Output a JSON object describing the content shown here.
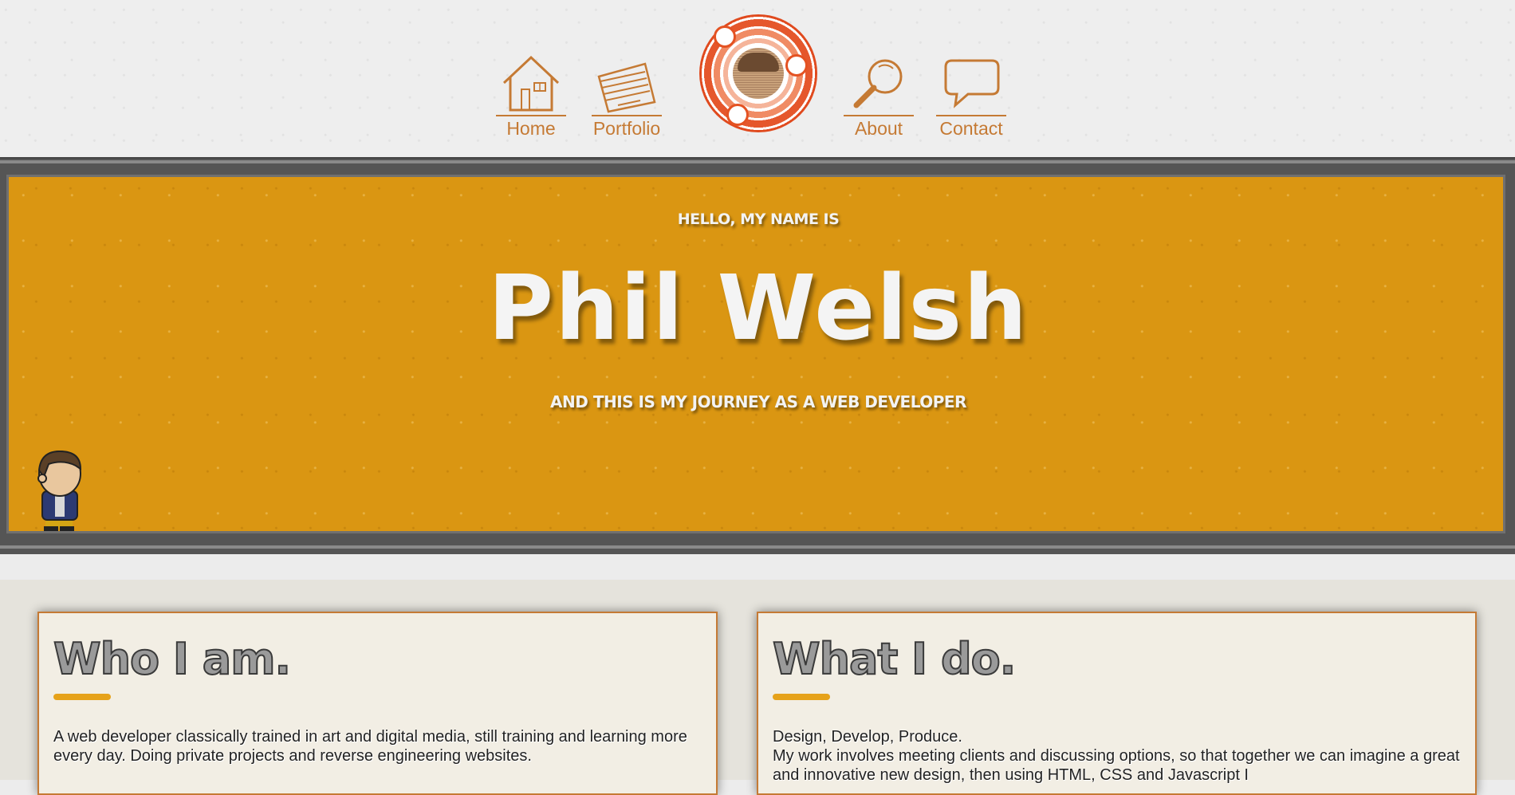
{
  "nav": {
    "items": [
      {
        "label": "Home",
        "icon": "house-icon"
      },
      {
        "label": "Portfolio",
        "icon": "papers-icon"
      },
      {
        "label": "About",
        "icon": "magnifier-icon"
      },
      {
        "label": "Contact",
        "icon": "speech-bubble-icon"
      }
    ]
  },
  "colors": {
    "nav_accent": "#c57a34",
    "hero_background": "#da9612",
    "logo_ring": "#e45222",
    "card_background": "#f2eee4"
  },
  "hero": {
    "intro": "HELLO, MY NAME IS",
    "name": "Phil Welsh",
    "tagline": "AND THIS IS MY JOURNEY AS A WEB DEVELOPER"
  },
  "cards": [
    {
      "title": "Who I am.",
      "text": "A web developer classically trained in art and digital media, still training and learning more every day. Doing private projects and reverse engineering websites."
    },
    {
      "title": "What I do.",
      "text": "Design, Develop, Produce.\nMy work involves meeting clients and discussing options, so that together we can imagine a great and innovative new design, then using HTML, CSS and Javascript I"
    }
  ]
}
